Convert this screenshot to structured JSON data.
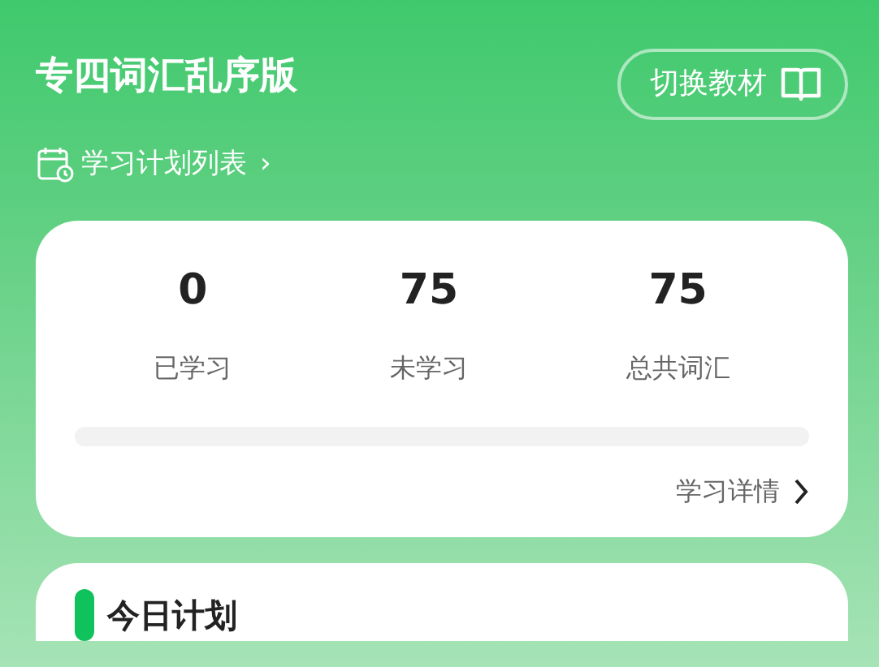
{
  "header": {
    "title": "专四词汇乱序版",
    "switch_button": "切换教材",
    "plan_link": "学习计划列表",
    "plan_link_arrow": "›"
  },
  "stats_card": {
    "stats": [
      {
        "value": "0",
        "label": "已学习"
      },
      {
        "value": "75",
        "label": "未学习"
      },
      {
        "value": "75",
        "label": "总共词汇"
      }
    ],
    "progress": {
      "level": 0
    },
    "details_link": "学习详情"
  },
  "today_card": {
    "title": "今日计划"
  }
}
